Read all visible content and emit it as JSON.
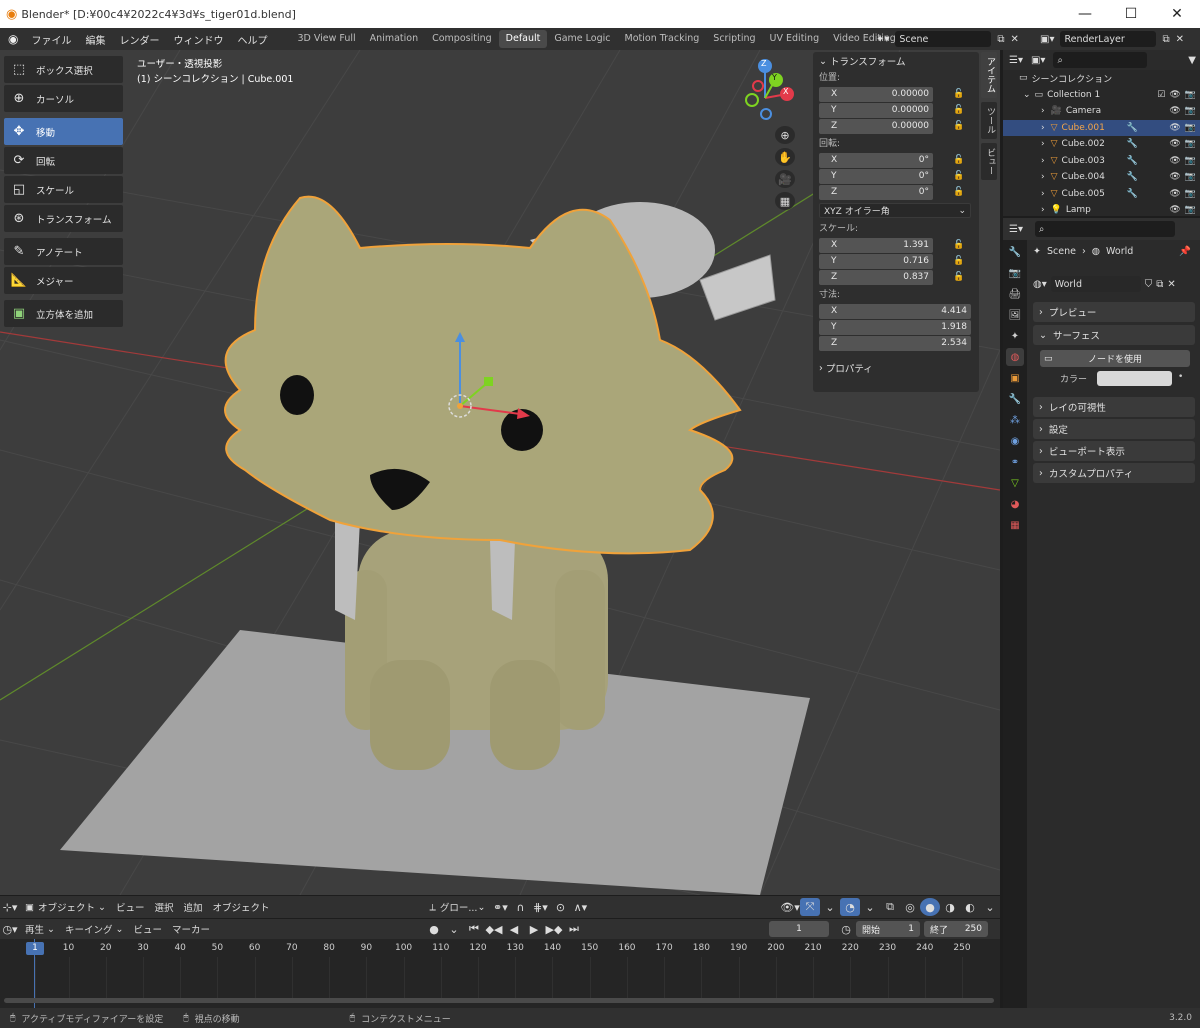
{
  "titlebar": {
    "title": "Blender* [D:¥00c4¥2022c4¥3d¥s_tiger01d.blend]"
  },
  "menu": {
    "items": [
      "ファイル",
      "編集",
      "レンダー",
      "ウィンドウ",
      "ヘルプ"
    ],
    "workspaces": [
      "3D View Full",
      "Animation",
      "Compositing",
      "Default",
      "Game Logic",
      "Motion Tracking",
      "Scripting",
      "UV Editing",
      "Video Editing"
    ],
    "active_workspace": "Default",
    "add_tab": "+",
    "scene": "Scene",
    "render_layer": "RenderLayer"
  },
  "toolbar": {
    "tools": [
      "ボックス選択",
      "カーソル",
      "移動",
      "回転",
      "スケール",
      "トランスフォーム",
      "アノテート",
      "メジャー",
      "立方体を追加"
    ],
    "active": "移動"
  },
  "viewport": {
    "view_name": "ユーザー・透視投影",
    "collection_line": "(1) シーンコレクション | Cube.001",
    "axes": [
      "X",
      "Y",
      "Z"
    ]
  },
  "npanel": {
    "header": "トランスフォーム",
    "location_label": "位置:",
    "location": [
      [
        "X",
        "0.00000"
      ],
      [
        "Y",
        "0.00000"
      ],
      [
        "Z",
        "0.00000"
      ]
    ],
    "rotation_label": "回転:",
    "rotation": [
      [
        "X",
        "0°"
      ],
      [
        "Y",
        "0°"
      ],
      [
        "Z",
        "0°"
      ]
    ],
    "rotation_mode": "XYZ オイラー角",
    "scale_label": "スケール:",
    "scale": [
      [
        "X",
        "1.391"
      ],
      [
        "Y",
        "0.716"
      ],
      [
        "Z",
        "0.837"
      ]
    ],
    "dimensions_label": "寸法:",
    "dimensions": [
      [
        "X",
        "4.414"
      ],
      [
        "Y",
        "1.918"
      ],
      [
        "Z",
        "2.534"
      ]
    ],
    "properties": "プロパティ",
    "tabs": [
      "アイテム",
      "ツール",
      "ビュー"
    ]
  },
  "outliner": {
    "root": "シーンコレクション",
    "collection": "Collection 1",
    "items": [
      "Camera",
      "Cube.001",
      "Cube.002",
      "Cube.003",
      "Cube.004",
      "Cube.005",
      "Lamp"
    ],
    "selected": "Cube.001"
  },
  "properties": {
    "breadcrumb_scene": "Scene",
    "breadcrumb_world": "World",
    "world_name": "World",
    "preview": "プレビュー",
    "surface": "サーフェス",
    "use_nodes": "ノードを使用",
    "color_label": "カラー",
    "color_value": "#d8d8d8",
    "ray_visibility": "レイの可視性",
    "settings": "設定",
    "viewport_display": "ビューポート表示",
    "custom_props": "カスタムプロパティ"
  },
  "viewport_header": {
    "mode": "オブジェクト",
    "menus": [
      "ビュー",
      "選択",
      "追加",
      "オブジェクト"
    ],
    "orientation": "グロー..."
  },
  "timeline": {
    "menus": [
      "再生",
      "キーイング",
      "ビュー",
      "マーカー"
    ],
    "current_frame": "1",
    "start_label": "開始",
    "start": "1",
    "end_label": "終了",
    "end": "250",
    "ticks": [
      "1",
      "10",
      "20",
      "30",
      "40",
      "50",
      "60",
      "70",
      "80",
      "90",
      "100",
      "110",
      "120",
      "130",
      "140",
      "150",
      "160",
      "170",
      "180",
      "190",
      "200",
      "210",
      "220",
      "230",
      "240",
      "250"
    ]
  },
  "statusbar": {
    "hint1": "アクティブモディファイアーを設定",
    "hint2": "視点の移動",
    "hint3": "コンテクストメニュー",
    "version": "3.2.0"
  }
}
